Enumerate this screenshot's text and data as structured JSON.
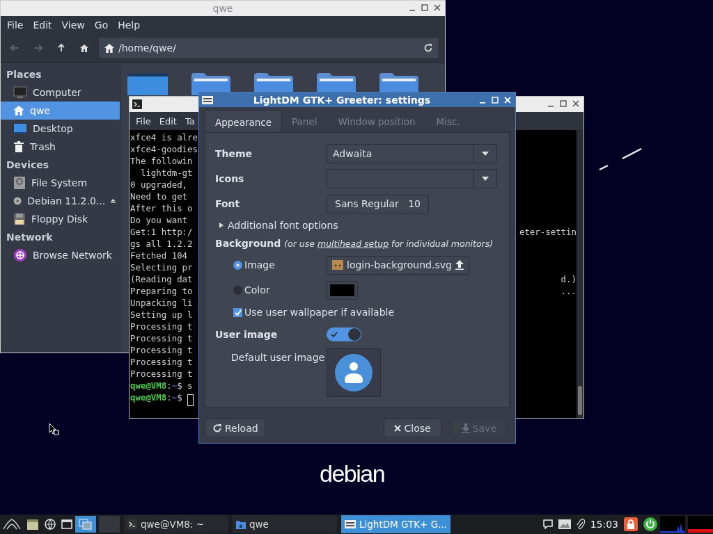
{
  "desktop": {
    "logo": "debian"
  },
  "file_manager": {
    "title": "qwe",
    "menu": [
      "File",
      "Edit",
      "View",
      "Go",
      "Help"
    ],
    "location": "/home/qwe/",
    "sidebar": [
      {
        "heading": "Places",
        "items": [
          {
            "label": "Computer",
            "kind": "computer",
            "selected": false,
            "ejectable": false
          },
          {
            "label": "qwe",
            "kind": "home",
            "selected": true,
            "ejectable": false
          },
          {
            "label": "Desktop",
            "kind": "desktop",
            "selected": false,
            "ejectable": false
          },
          {
            "label": "Trash",
            "kind": "trash",
            "selected": false,
            "ejectable": false
          }
        ]
      },
      {
        "heading": "Devices",
        "items": [
          {
            "label": "File System",
            "kind": "drive",
            "selected": false,
            "ejectable": false
          },
          {
            "label": "Debian 11.2.0...",
            "kind": "disc",
            "selected": false,
            "ejectable": true
          },
          {
            "label": "Floppy Disk",
            "kind": "floppy",
            "selected": false,
            "ejectable": false
          }
        ]
      },
      {
        "heading": "Network",
        "items": [
          {
            "label": "Browse Network",
            "kind": "network",
            "selected": false,
            "ejectable": false
          }
        ]
      }
    ]
  },
  "terminal": {
    "menu": [
      "File",
      "Edit",
      "Ta"
    ],
    "lines": [
      {
        "kind": "output",
        "text": "xfce4 is alre"
      },
      {
        "kind": "output",
        "text": "xfce4-goodies"
      },
      {
        "kind": "output",
        "text": "The followin"
      },
      {
        "kind": "output",
        "text": "  lightdm-gt"
      },
      {
        "kind": "output",
        "text": "0 upgraded,"
      },
      {
        "kind": "output",
        "text": "Need to get"
      },
      {
        "kind": "output",
        "text": "After this o"
      },
      {
        "kind": "output",
        "text": "Do you want"
      },
      {
        "kind": "output",
        "text": "Get:1 http:/",
        "tail": "eter-settin"
      },
      {
        "kind": "output",
        "text": "gs all 1.2.2"
      },
      {
        "kind": "output",
        "text": "Fetched 104"
      },
      {
        "kind": "output",
        "text": "Selecting pr"
      },
      {
        "kind": "output",
        "text": "(Reading dat",
        "tail": "d.)"
      },
      {
        "kind": "output",
        "text": "Preparing to",
        "tail": "..."
      },
      {
        "kind": "output",
        "text": "Unpacking li"
      },
      {
        "kind": "output",
        "text": "Setting up l"
      },
      {
        "kind": "output",
        "text": "Processing t"
      },
      {
        "kind": "output",
        "text": "Processing t"
      },
      {
        "kind": "output",
        "text": "Processing t"
      },
      {
        "kind": "output",
        "text": "Processing t"
      },
      {
        "kind": "output",
        "text": "Processing t"
      },
      {
        "kind": "prompt",
        "user": "qwe@VM8",
        "sep": ":",
        "path": "~",
        "sigil": "$",
        "command": "s",
        "cursor": false
      },
      {
        "kind": "prompt",
        "user": "qwe@VM8",
        "sep": ":",
        "path": "~",
        "sigil": "$",
        "cursor": true
      }
    ]
  },
  "greeter": {
    "title": "LightDM GTK+ Greeter: settings",
    "tabs": [
      {
        "label": "Appearance",
        "selected": true
      },
      {
        "label": "Panel",
        "selected": false
      },
      {
        "label": "Window position",
        "selected": false
      },
      {
        "label": "Misc.",
        "selected": false
      }
    ],
    "theme": {
      "label": "Theme",
      "value": "Adwaita"
    },
    "icons": {
      "label": "Icons"
    },
    "font": {
      "label": "Font",
      "name": "Sans Regular",
      "size": "10"
    },
    "font_options": {
      "label": "Additional font options",
      "expanded": false
    },
    "background": {
      "label": "Background",
      "note_before": "(or use",
      "link": "multihead setup",
      "note_after": "for individual monitors)"
    },
    "image_option": {
      "label": "Image",
      "selected": true,
      "file": "login-background.svg"
    },
    "color_option": {
      "label": "Color",
      "selected": false,
      "color": "#000000"
    },
    "wallpaper": {
      "label": "Use user wallpaper if available",
      "checked": true
    },
    "user_image": {
      "label": "User image",
      "on": true
    },
    "default_image": {
      "label": "Default user image"
    },
    "buttons": [
      {
        "label": "Reload",
        "kind": "reload",
        "disabled": false
      },
      {
        "label": "Close",
        "kind": "close",
        "disabled": false
      },
      {
        "label": "Save",
        "kind": "save",
        "disabled": true
      }
    ]
  },
  "taskbar": {
    "tasks": [
      {
        "label": "qwe@VM8: ~",
        "kind": "terminal",
        "selected": false
      },
      {
        "label": "qwe",
        "kind": "folder",
        "selected": false
      },
      {
        "label": "LightDM GTK+ G...",
        "kind": "settings",
        "selected": true
      }
    ],
    "clock": "15:03"
  }
}
